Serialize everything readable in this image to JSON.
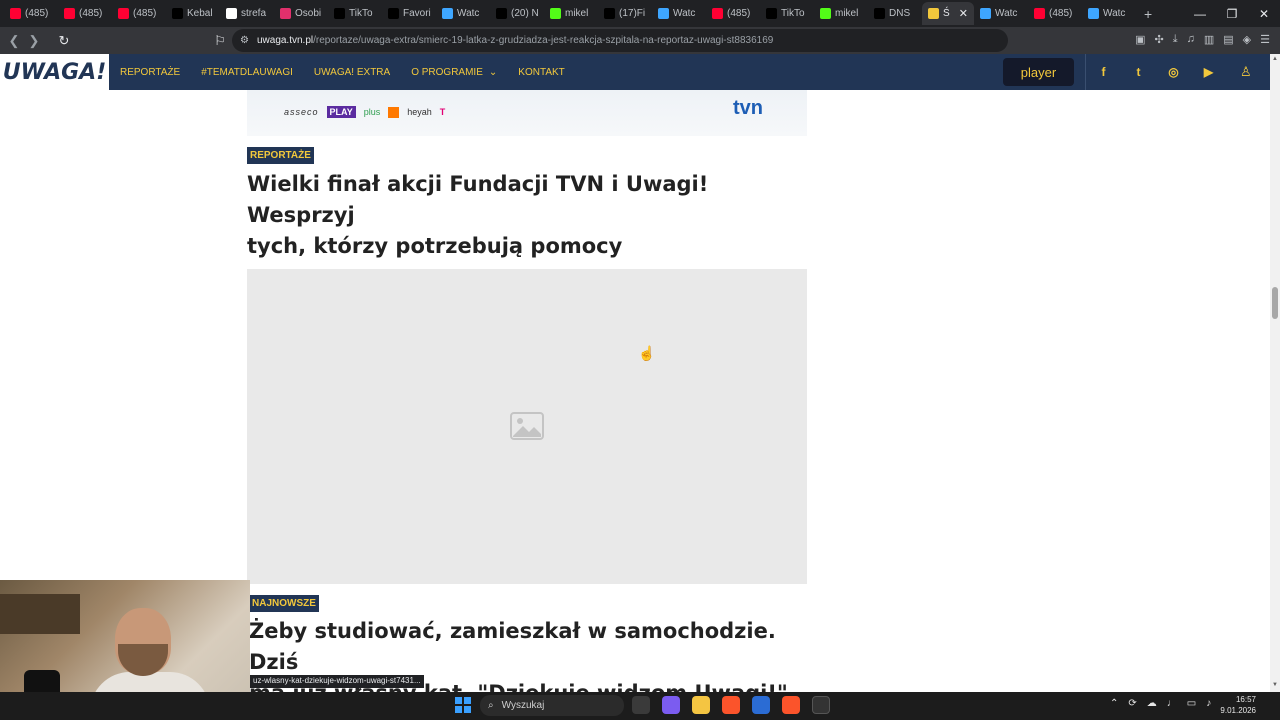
{
  "browser": {
    "tabs": [
      {
        "label": "(485)",
        "favicon_color": "#ff0033"
      },
      {
        "label": "(485)",
        "favicon_color": "#ff0033"
      },
      {
        "label": "(485)",
        "favicon_color": "#ff0033"
      },
      {
        "label": "Kebal",
        "favicon_color": "#000000"
      },
      {
        "label": "strefa",
        "favicon_color": "#ffffff"
      },
      {
        "label": "Osobi",
        "favicon_color": "#e1306c"
      },
      {
        "label": "TikTo",
        "favicon_color": "#000000"
      },
      {
        "label": "Favori",
        "favicon_color": "#000000"
      },
      {
        "label": "Watc",
        "favicon_color": "#3ea6ff"
      },
      {
        "label": "(20) N",
        "favicon_color": "#000000"
      },
      {
        "label": "mikel",
        "favicon_color": "#53fc18"
      },
      {
        "label": "(17)Fi",
        "favicon_color": "#000000"
      },
      {
        "label": "Watc",
        "favicon_color": "#3ea6ff"
      },
      {
        "label": "(485)",
        "favicon_color": "#ff0033"
      },
      {
        "label": "TikTo",
        "favicon_color": "#000000"
      },
      {
        "label": "mikel",
        "favicon_color": "#53fc18"
      },
      {
        "label": "DNS",
        "favicon_color": "#000000"
      },
      {
        "label": "Ś",
        "favicon_color": "#f2c83c",
        "active": true
      },
      {
        "label": "Watc",
        "favicon_color": "#3ea6ff"
      },
      {
        "label": "(485)",
        "favicon_color": "#ff0033"
      },
      {
        "label": "Watc",
        "favicon_color": "#3ea6ff"
      }
    ],
    "new_tab": "+",
    "url_host": "uwaga.tvn.pl",
    "url_path": "/reportaze/uwaga-extra/smierc-19-latka-z-grudziadza-jest-reakcja-szpitala-na-reportaz-uwagi-st8836169",
    "status_url": "uz-wlasny-kat-dziekuje-widzom-uwagi-st7431..."
  },
  "site": {
    "logo": "UWAGA!",
    "nav": [
      {
        "label": "REPORTAŻE"
      },
      {
        "label": "#TEMATDLAUWAGI"
      },
      {
        "label": "UWAGA! EXTRA"
      },
      {
        "label": "O PROGRAMIE",
        "has_dropdown": true
      },
      {
        "label": "KONTAKT"
      }
    ],
    "player_label": "player",
    "social": [
      "facebook-icon",
      "twitter-icon",
      "instagram-icon",
      "youtube-icon"
    ]
  },
  "banner": {
    "sponsors": [
      "asseco",
      "PLAY",
      "plus",
      "heyah",
      "T"
    ],
    "brand": "tvn"
  },
  "articles": [
    {
      "category": "REPORTAŻE",
      "title_line1": "Wielki finał akcji Fundacji TVN i Uwagi! Wesprzyj",
      "title_line2": "tych, którzy potrzebują pomocy"
    },
    {
      "category": "NAJNOWSZE",
      "title_line1": "Żeby studiować, zamieszkał w samochodzie. Dziś",
      "title_line2": "ma już własny kąt. \"Dziękuję widzom Uwagi!\""
    }
  ],
  "taskbar": {
    "search_placeholder": "Wyszukaj",
    "time": "16:57",
    "date": "9.01.2026"
  },
  "colors": {
    "header_bg": "#213555",
    "accent": "#f2c83c"
  }
}
